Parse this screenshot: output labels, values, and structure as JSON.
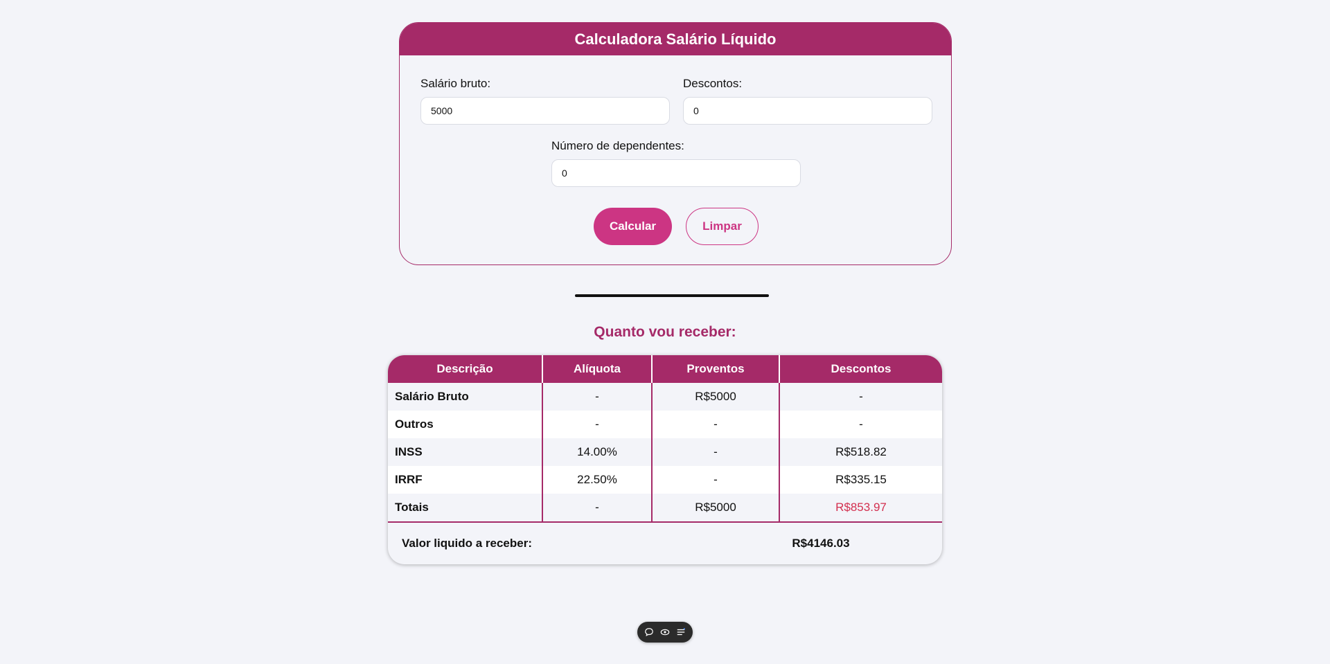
{
  "calculator": {
    "title": "Calculadora Salário Líquido",
    "salary_label": "Salário bruto:",
    "salary_value": "5000",
    "discounts_label": "Descontos:",
    "discounts_value": "0",
    "dependents_label": "Número de dependentes:",
    "dependents_value": "0",
    "calculate_label": "Calcular",
    "clear_label": "Limpar"
  },
  "results": {
    "title": "Quanto vou receber:",
    "headers": [
      "Descrição",
      "Alíquota",
      "Proventos",
      "Descontos"
    ],
    "rows": [
      {
        "desc": "Salário Bruto",
        "rate": "-",
        "earnings": "R$5000",
        "deductions": "-"
      },
      {
        "desc": "Outros",
        "rate": "-",
        "earnings": "-",
        "deductions": "-"
      },
      {
        "desc": "INSS",
        "rate": "14.00%",
        "earnings": "-",
        "deductions": "R$518.82"
      },
      {
        "desc": "IRRF",
        "rate": "22.50%",
        "earnings": "-",
        "deductions": "R$335.15"
      },
      {
        "desc": "Totais",
        "rate": "-",
        "earnings": "R$5000",
        "deductions": "R$853.97"
      }
    ],
    "net_label": "Valor liquido a receber:",
    "net_value": "R$4146.03"
  },
  "toolbar": {
    "icons": [
      "comment-icon",
      "eye-icon",
      "menu-icon"
    ]
  },
  "colors": {
    "primary": "#a52a68",
    "button": "#cc3583",
    "negative": "#d32f4f",
    "background": "#f3f4f9"
  }
}
